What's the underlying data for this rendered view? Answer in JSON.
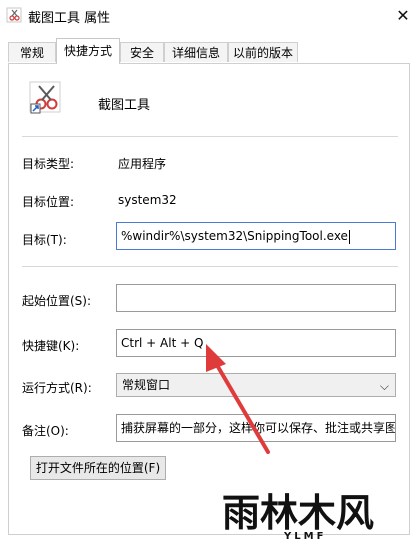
{
  "window": {
    "title": "截图工具 属性",
    "close_glyph": "✕"
  },
  "tabs": [
    {
      "label": "常规",
      "active": false
    },
    {
      "label": "快捷方式",
      "active": true
    },
    {
      "label": "安全",
      "active": false
    },
    {
      "label": "详细信息",
      "active": false
    },
    {
      "label": "以前的版本",
      "active": false
    }
  ],
  "shortcut": {
    "program_name": "截图工具",
    "target_type_label": "目标类型:",
    "target_type_value": "应用程序",
    "target_location_label": "目标位置:",
    "target_location_value": "system32",
    "target_label": "目标(T):",
    "target_value": "%windir%\\system32\\SnippingTool.exe",
    "start_in_label": "起始位置(S):",
    "start_in_value": "",
    "hotkey_label": "快捷键(K):",
    "hotkey_value": "Ctrl + Alt + Q",
    "run_label": "运行方式(R):",
    "run_value": "常规窗口",
    "comment_label": "备注(O):",
    "comment_value": "捕获屏幕的一部分，这样你可以保存、批注或共享图",
    "open_location_button": "打开文件所在的位置(F)"
  },
  "watermark": {
    "text": "雨林木风",
    "sub": "YLMF"
  },
  "colors": {
    "accent": "#4a7bd4",
    "annotation_arrow": "#e03b3b"
  },
  "icons": [
    "snipping-tool-icon",
    "close-icon",
    "chevron-down-icon"
  ]
}
